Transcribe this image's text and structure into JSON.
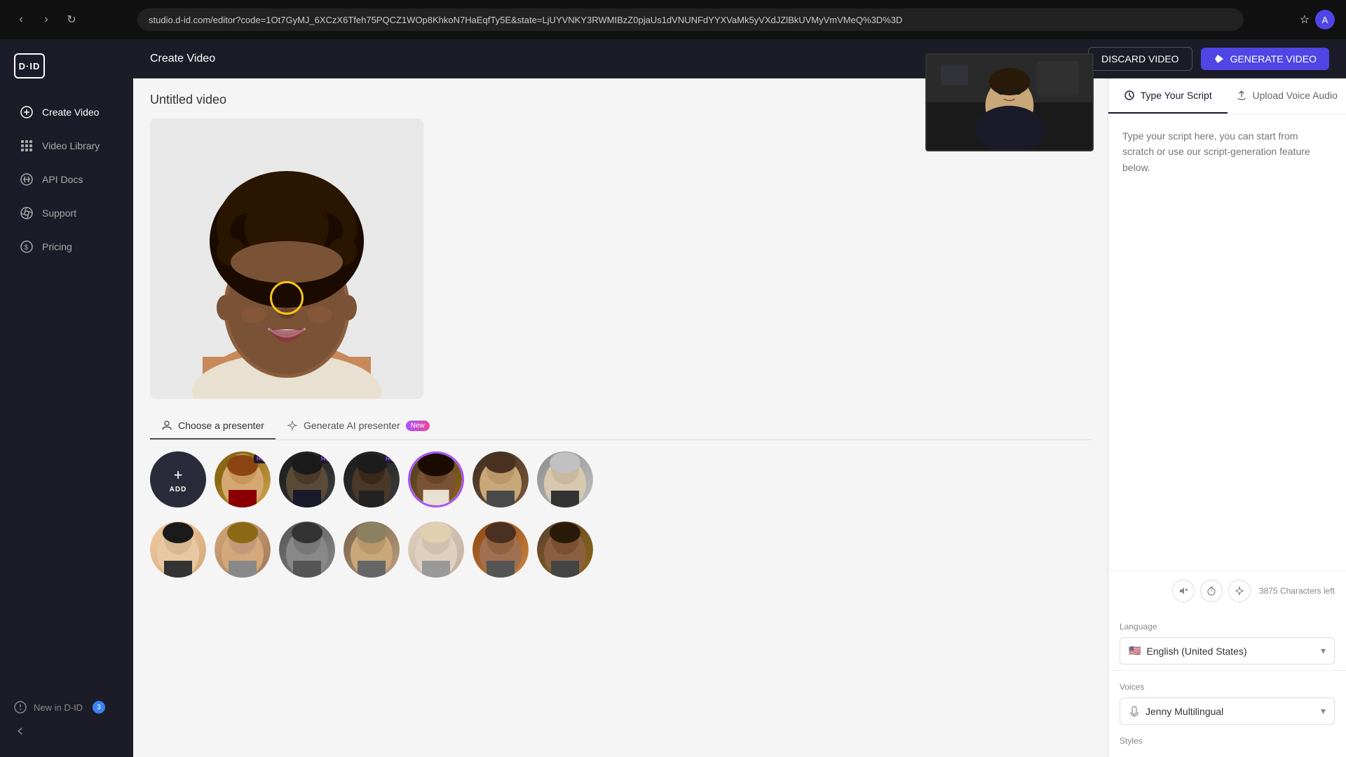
{
  "browser": {
    "url": "studio.d-id.com/editor?code=1Ot7GyMJ_6XCzX6Tfeh75PQCZ1WOp8KhkoN7HaEqfTy5E&state=LjUYVNKY3RWMIBzZ0pjaUs1dVNUNFdYYXVaMk5yVXdJZlBkUVMyVmVMeQ%3D%3D",
    "nav": {
      "back": "‹",
      "forward": "›",
      "refresh": "↻"
    }
  },
  "app": {
    "logo": "D·ID",
    "header_title": "Create Video",
    "discard_btn": "DISCARD VIDEO",
    "generate_btn": "GENERATE VIDEO"
  },
  "sidebar": {
    "items": [
      {
        "id": "create-video",
        "label": "Create Video",
        "icon": "+"
      },
      {
        "id": "video-library",
        "label": "Video Library",
        "icon": "⊞"
      },
      {
        "id": "api-docs",
        "label": "API Docs",
        "icon": "✕"
      },
      {
        "id": "support",
        "label": "Support",
        "icon": "✕"
      },
      {
        "id": "pricing",
        "label": "Pricing",
        "icon": "$"
      }
    ],
    "bottom": {
      "new_in_did": "New in D-ID",
      "badge": "3"
    }
  },
  "editor": {
    "video_title": "Untitled video",
    "presenter_tabs": [
      {
        "id": "choose",
        "label": "Choose a presenter",
        "active": true
      },
      {
        "id": "generate",
        "label": "Generate AI presenter",
        "is_new": true
      }
    ],
    "presenters_row1": [
      {
        "id": "add",
        "label": "ADD"
      },
      {
        "id": "p1",
        "color_class": "p1",
        "hq": true
      },
      {
        "id": "p2",
        "color_class": "p2",
        "hq": true
      },
      {
        "id": "p3",
        "color_class": "p3",
        "hq": true
      },
      {
        "id": "p4",
        "color_class": "p4",
        "selected": true
      },
      {
        "id": "p5",
        "color_class": "p5"
      },
      {
        "id": "p6",
        "color_class": "p6"
      }
    ],
    "presenters_row2": [
      {
        "id": "p8",
        "color_class": "p8"
      },
      {
        "id": "p9",
        "color_class": "p9"
      },
      {
        "id": "p10",
        "color_class": "p10"
      },
      {
        "id": "p11",
        "color_class": "p11"
      },
      {
        "id": "p12",
        "color_class": "p12"
      },
      {
        "id": "p13",
        "color_class": "p13"
      },
      {
        "id": "p14",
        "color_class": "p14"
      }
    ]
  },
  "script_panel": {
    "tab_script": "Type Your Script",
    "tab_audio": "Upload Voice Audio",
    "placeholder": "Type your script here, you can start from scratch or use our script-generation feature below.",
    "char_count": "3875 Characters left",
    "language_label": "Language",
    "language_value": "English (United States)",
    "voices_label": "Voices",
    "voice_value": "Jenny Multilingual",
    "styles_label": "Styles"
  },
  "icons": {
    "script_tab_icon": "○",
    "audio_tab_icon": "↑",
    "mute_icon": "🔇",
    "timer_icon": "⏱",
    "magic_icon": "✦",
    "chevron_down": "▾",
    "check": "✓",
    "video_icon": "▶",
    "flag_us": "🇺🇸",
    "voice_icon": "♫"
  }
}
